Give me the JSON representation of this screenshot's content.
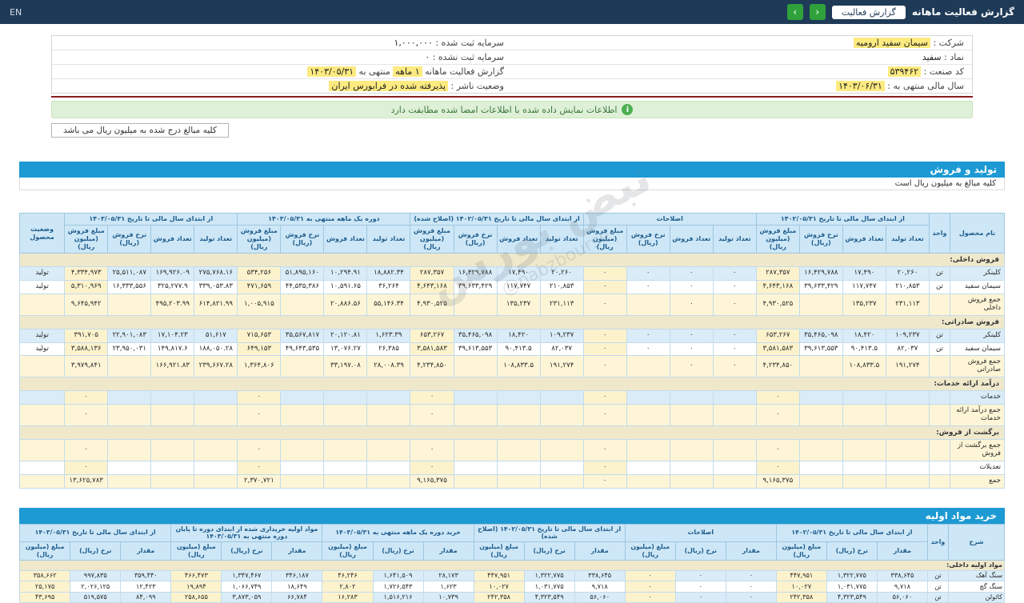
{
  "navbar": {
    "title": "گزارش فعالیت ماهانه",
    "report_button": "گزارش فعالیت",
    "prev_icon": "‹",
    "next_icon": "›",
    "lang": "EN"
  },
  "info": {
    "company_label": "شرکت :",
    "company_value": "سیمان سفید ارومیه",
    "symbol_label": "نماد :",
    "symbol_value": "سفید",
    "industry_label": "کد صنعت :",
    "industry_value": "۵۳۹۴۶۲",
    "fiscal_label": "سال مالی منتهی به :",
    "fiscal_value": "۱۴۰۳/۰۶/۳۱",
    "registered_capital_label": "سرمایه ثبت شده :",
    "registered_capital_value": "۱,۰۰۰,۰۰۰",
    "unregistered_capital_label": "سرمایه ثبت نشده :",
    "unregistered_capital_value": "۰",
    "report_line": {
      "pre": "گزارش فعالیت ماهانه",
      "period": "۱ ماهه",
      "mid": "منتهی به",
      "date": "۱۴۰۳/۰۵/۳۱"
    },
    "status_label": "وضعیت ناشر :",
    "status_value": "پذیرفته شده در فرابورس ایران"
  },
  "alert": {
    "text": "اطلاعات نمایش داده شده با اطلاعات امضا شده مطابقت دارد"
  },
  "note_box": "کلیه مبالغ درج شده به میلیون ریال می باشد",
  "watermark": {
    "line1": "نبض بورس",
    "line2": "@nabzbourse"
  },
  "section1": {
    "title": "تولید و فروش",
    "subtitle": "کلیه مبالغ به میلیون ریال است",
    "table": {
      "first_cols": [
        "نام محصول",
        "واحد"
      ],
      "last_col": "وضعیت محصول",
      "groups": [
        {
          "label": "از ابتدای سال مالی تا تاریخ ۱۴۰۲/۰۵/۳۱",
          "cols": [
            "تعداد تولید",
            "تعداد فروش",
            "نرخ فروش (ریال)",
            "مبلغ فروش (میلیون ریال)"
          ]
        },
        {
          "label": "اصلاحات",
          "cols": [
            "تعداد تولید",
            "تعداد فروش",
            "نرخ فروش (ریال)",
            "مبلغ فروش (میلیون ریال)"
          ]
        },
        {
          "label": "از ابتدای سال مالی تا تاریخ ۱۴۰۲/۰۵/۳۱ (اصلاح شده)",
          "cols": [
            "تعداد تولید",
            "تعداد فروش",
            "نرخ فروش (ریال)",
            "مبلغ فروش (میلیون ریال)"
          ]
        },
        {
          "label": "دوره یک ماهه منتهی به ۱۴۰۳/۰۵/۳۱",
          "cols": [
            "تعداد تولید",
            "تعداد فروش",
            "نرخ فروش (ریال)",
            "مبلغ فروش (میلیون ریال)"
          ]
        },
        {
          "label": "از ابتدای سال مالی تا تاریخ ۱۴۰۳/۰۵/۳۱",
          "cols": [
            "تعداد تولید",
            "تعداد فروش",
            "نرخ فروش (ریال)",
            "مبلغ فروش (میلیون ریال)"
          ]
        }
      ],
      "rows": [
        {
          "type": "label",
          "name": "فروش داخلی:"
        },
        {
          "type": "data",
          "name": "کلینکر",
          "unit": "تن",
          "status": "تولید",
          "cells": [
            "۲۰,۲۶۰",
            "۱۷,۴۹۰",
            "۱۶,۴۲۹,۷۸۸",
            "۲۸۷,۳۵۷",
            "۰",
            "۰",
            "۰",
            "۰",
            "۲۰,۲۶۰",
            "۱۷,۴۹۰",
            "۱۶,۴۲۹,۷۸۸",
            "۲۸۷,۳۵۷",
            "۱۸,۸۸۲.۳۴",
            "۱۰,۲۹۴.۹۱",
            "۵۱,۸۹۵,۱۶۰",
            "۵۳۴,۲۵۶",
            "۲۷۵,۷۶۸.۱۶",
            "۱۶۹,۹۲۶.۰۹",
            "۲۵,۵۱۱,۰۸۷",
            "۴,۳۳۴,۹۷۳"
          ]
        },
        {
          "type": "data",
          "name": "سیمان سفید",
          "unit": "تن",
          "status": "تولید",
          "cells": [
            "۲۱۰,۸۵۳",
            "۱۱۷,۷۴۷",
            "۳۹,۶۳۳,۴۲۹",
            "۴,۶۴۳,۱۶۸",
            "۰",
            "۰",
            "۰",
            "۰",
            "۲۱۰,۸۵۳",
            "۱۱۷,۷۴۷",
            "۳۹,۶۳۳,۴۲۹",
            "۴,۶۴۳,۱۶۸",
            "۳۶,۲۶۴",
            "۱۰,۵۹۱.۶۵",
            "۴۴,۵۳۵,۳۸۶",
            "۴۷۱,۶۵۹",
            "۳۳۹,۰۵۳.۸۳",
            "۳۲۵,۲۷۷.۹",
            "۱۶,۳۳۳,۵۵۶",
            "۵,۳۱۰,۹۶۹"
          ]
        },
        {
          "type": "sum",
          "name": "جمع فروش داخلی",
          "unit": "",
          "status": "",
          "cells": [
            "۲۳۱,۱۱۳",
            "۱۳۵,۲۳۷",
            "",
            "۴,۹۳۰,۵۲۵",
            "۰",
            "۰",
            "",
            "۰",
            "۲۳۱,۱۱۳",
            "۱۳۵,۲۳۷",
            "",
            "۴,۹۳۰,۵۲۵",
            "۵۵,۱۴۶.۳۴",
            "۲۰,۸۸۶.۵۶",
            "",
            "۱,۰۰۵,۹۱۵",
            "۶۱۴,۸۲۱.۹۹",
            "۴۹۵,۲۰۳.۹۹",
            "",
            "۹,۶۴۵,۹۴۲"
          ]
        },
        {
          "type": "label",
          "name": "فروش صادراتی:"
        },
        {
          "type": "data",
          "name": "کلینکر",
          "unit": "تن",
          "status": "تولید",
          "cells": [
            "۱۰۹,۲۳۷",
            "۱۸,۴۲۰",
            "۳۵,۴۶۵,۰۹۸",
            "۶۵۳,۲۶۷",
            "۰",
            "۰",
            "۰",
            "۰",
            "۱۰۹,۲۳۷",
            "۱۸,۴۲۰",
            "۳۵,۴۶۵,۰۹۸",
            "۶۵۳,۲۶۷",
            "۱,۶۲۳.۳۹",
            "۲۰,۱۲۰.۸۱",
            "۳۵,۵۶۷,۸۱۷",
            "۷۱۵,۶۵۳",
            "۵۱,۶۱۷",
            "۱۷,۱۰۴.۲۳",
            "۲۲,۹۰۱,۰۸۳",
            "۳۹۱,۷۰۵"
          ]
        },
        {
          "type": "data",
          "name": "سیمان سفید",
          "unit": "تن",
          "status": "تولید",
          "cells": [
            "۸۲,۰۳۷",
            "۹۰,۴۱۳.۵",
            "۳۹,۶۱۳,۵۵۳",
            "۳,۵۸۱,۵۸۳",
            "۰",
            "۰",
            "۰",
            "۰",
            "۸۲,۰۳۷",
            "۹۰,۴۱۳.۵",
            "۳۹,۶۱۳,۵۵۳",
            "۳,۵۸۱,۵۸۳",
            "۲۶,۳۸۵",
            "۱۳,۰۷۶.۲۷",
            "۴۹,۶۴۳,۵۳۵",
            "۶۴۹,۱۵۳",
            "۱۸۸,۰۵۰.۲۸",
            "۱۴۹,۸۱۷.۶",
            "۲۳,۹۵۰,۰۳۱",
            "۳,۵۸۸,۱۳۶"
          ]
        },
        {
          "type": "sum",
          "name": "جمع فروش صادراتی",
          "unit": "",
          "status": "",
          "cells": [
            "۱۹۱,۲۷۴",
            "۱۰۸,۸۳۳.۵",
            "",
            "۴,۲۳۴,۸۵۰",
            "۰",
            "۰",
            "",
            "۰",
            "۱۹۱,۲۷۴",
            "۱۰۸,۸۳۳.۵",
            "",
            "۴,۲۳۴,۸۵۰",
            "۲۸,۰۰۸.۳۹",
            "۳۳,۱۹۷.۰۸",
            "",
            "۱,۳۶۴,۸۰۶",
            "۲۳۹,۶۶۷.۲۸",
            "۱۶۶,۹۲۱.۸۳",
            "",
            "۳,۹۷۹,۸۴۱"
          ]
        },
        {
          "type": "label",
          "name": "درآمد ارائه خدمات:"
        },
        {
          "type": "data",
          "name": "خدمات",
          "unit": "",
          "status": "",
          "cells": [
            "",
            "",
            "",
            "۰",
            "",
            "",
            "",
            "۰",
            "",
            "",
            "",
            "۰",
            "",
            "",
            "",
            "۰",
            "",
            "",
            "",
            "۰"
          ]
        },
        {
          "type": "sum",
          "name": "جمع درآمد ارائه خدمات",
          "unit": "",
          "status": "",
          "cells": [
            "",
            "",
            "",
            "۰",
            "",
            "",
            "",
            "۰",
            "",
            "",
            "",
            "۰",
            "",
            "",
            "",
            "۰",
            "",
            "",
            "",
            "۰"
          ]
        },
        {
          "type": "label",
          "name": "برگشت از فروش:"
        },
        {
          "type": "sum",
          "name": "جمع برگشت از فروش",
          "unit": "",
          "status": "",
          "cells": [
            "",
            "",
            "",
            "۰",
            "",
            "",
            "",
            "۰",
            "",
            "",
            "",
            "۰",
            "",
            "",
            "",
            "۰",
            "",
            "",
            "",
            "۰"
          ]
        },
        {
          "type": "data",
          "name": "تعدیلات",
          "unit": "",
          "status": "",
          "cells": [
            "",
            "",
            "",
            "۰",
            "",
            "",
            "",
            "۰",
            "",
            "",
            "",
            "۰",
            "",
            "",
            "",
            "۰",
            "",
            "",
            "",
            "۰"
          ]
        },
        {
          "type": "sum",
          "name": "جمع",
          "unit": "",
          "status": "",
          "cells": [
            "",
            "",
            "",
            "۹,۱۶۵,۳۷۵",
            "",
            "",
            "",
            "۰",
            "",
            "",
            "",
            "۹,۱۶۵,۳۷۵",
            "",
            "",
            "",
            "۲,۳۷۰,۷۲۱",
            "",
            "",
            "",
            "۱۳,۶۲۵,۷۸۳"
          ]
        }
      ]
    }
  },
  "section2": {
    "title": "خرید مواد اولیه",
    "table": {
      "first_cols": [
        "شرح",
        "واحد"
      ],
      "last_col": null,
      "groups": [
        {
          "label": "از ابتدای سال مالی تا تاریخ ۱۴۰۲/۰۵/۳۱",
          "cols": [
            "مقدار",
            "نرخ (ریال)",
            "مبلغ (میلیون ریال)"
          ]
        },
        {
          "label": "اصلاحات",
          "cols": [
            "مقدار",
            "نرخ (ریال)",
            "مبلغ (میلیون ریال)"
          ]
        },
        {
          "label": "از ابتدای سال مالی تا تاریخ ۱۴۰۲/۰۵/۳۱ (اصلاح شده)",
          "cols": [
            "مقدار",
            "نرخ (ریال)",
            "مبلغ (میلیون ریال)"
          ]
        },
        {
          "label": "خرید دوره یک ماهه منتهی به ۱۴۰۳/۰۵/۳۱",
          "cols": [
            "مقدار",
            "نرخ (ریال)",
            "مبلغ (میلیون ریال)"
          ]
        },
        {
          "label": "مواد اولیه خریداری شده از ابتدای دوره تا پایان دوره منتهی به ۱۴۰۳/۰۵/۳۱",
          "cols": [
            "مقدار",
            "نرخ (ریال)",
            "مبلغ (میلیون ریال)"
          ]
        },
        {
          "label": "از ابتدای سال مالی تا تاریخ ۱۴۰۳/۰۵/۳۱",
          "cols": [
            "مقدار",
            "نرخ (ریال)",
            "مبلغ (میلیون ریال)"
          ]
        }
      ],
      "rows": [
        {
          "type": "label",
          "name": "مواد اولیه داخلی:"
        },
        {
          "type": "data",
          "name": "سنگ آهک",
          "unit": "تن",
          "status": "",
          "cells": [
            "۳۳۸,۶۴۵",
            "۱,۳۲۲,۷۷۵",
            "۴۴۷,۹۵۱",
            "۰",
            "۰",
            "۰",
            "۳۳۸,۶۴۵",
            "۱,۳۲۲,۷۷۵",
            "۴۴۷,۹۵۱",
            "۲۸,۱۷۳",
            "۱,۶۴۱,۵۰۹",
            "۴۶,۲۴۶",
            "۳۴۶,۱۸۷",
            "۱,۳۴۷,۴۶۷",
            "۴۶۶,۴۷۳",
            "۳۵۹,۴۴۰",
            "۹۹۷,۸۳۵",
            "۳۵۸,۶۶۲"
          ]
        },
        {
          "type": "data",
          "name": "سنگ گچ",
          "unit": "تن",
          "status": "",
          "cells": [
            "۹,۷۱۸",
            "۱,۰۳۱,۷۷۵",
            "۱۰,۰۲۷",
            "۰",
            "۰",
            "۰",
            "۹,۷۱۸",
            "۱,۰۳۱,۷۷۵",
            "۱۰,۰۲۷",
            "۱,۶۲۳",
            "۱,۷۲۶,۵۴۳",
            "۲,۸۰۲",
            "۱۸,۶۴۹",
            "۱,۰۶۶,۷۴۹",
            "۱۹,۸۹۴",
            "۱۲,۴۲۳",
            "۲,۰۲۶,۱۲۵",
            "۲۵,۱۷۵"
          ]
        },
        {
          "type": "data",
          "name": "کائولن",
          "unit": "تن",
          "status": "",
          "cells": [
            "۵۶,۰۶۰",
            "۴,۳۲۳,۵۴۹",
            "۲۴۲,۳۵۸",
            "۰",
            "۰",
            "۰",
            "۵۶,۰۶۰",
            "۴,۳۲۳,۵۴۹",
            "۲۴۲,۳۵۸",
            "۱۰,۷۳۹",
            "۱,۵۱۶,۲۱۶",
            "۱۶,۲۸۳",
            "۶۶,۷۸۴",
            "۳,۸۷۳,۰۵۹",
            "۲۵۸,۶۵۵",
            "۸۴,۰۹۹",
            "۵۱۹,۵۷۵",
            "۴۳,۶۹۵"
          ]
        }
      ]
    }
  }
}
